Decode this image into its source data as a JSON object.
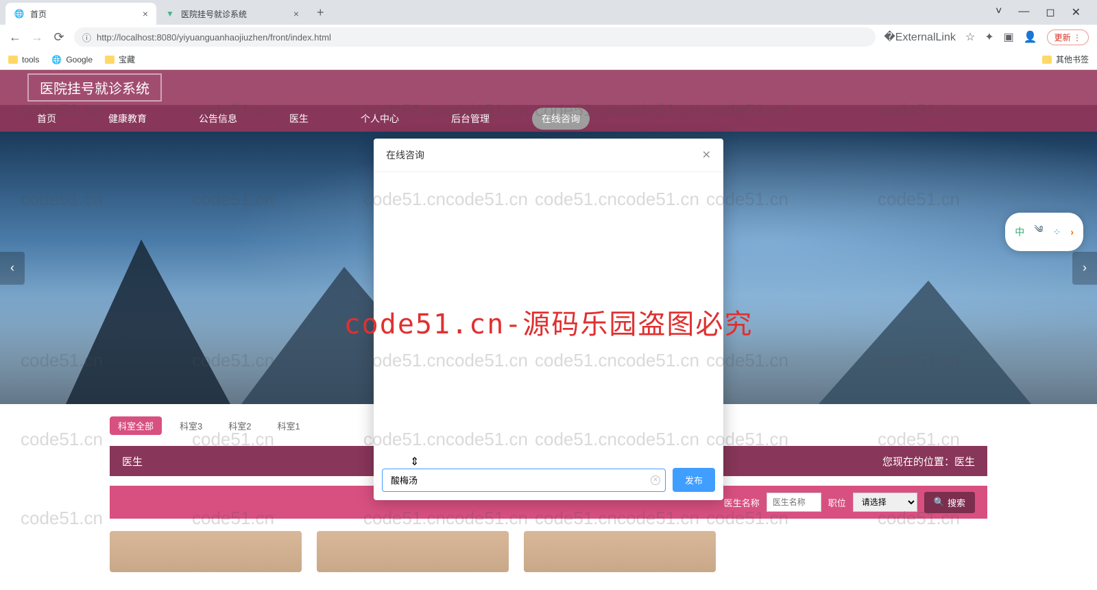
{
  "browser": {
    "tabs": [
      {
        "title": "首页",
        "icon": "globe"
      },
      {
        "title": "医院挂号就诊系统",
        "icon": "vue"
      }
    ],
    "url": "http://localhost:8080/yiyuanguanhaojiuzhen/front/index.html",
    "url_prefix_icon": "ⓘ",
    "bookmarks": [
      {
        "label": "tools",
        "type": "folder"
      },
      {
        "label": "Google",
        "type": "globe"
      },
      {
        "label": "宝藏",
        "type": "folder"
      }
    ],
    "bookmark_other": "其他书签",
    "update_label": "更新"
  },
  "site": {
    "title": "医院挂号就诊系统",
    "nav": [
      "首页",
      "健康教育",
      "公告信息",
      "医生",
      "个人中心",
      "后台管理",
      "在线咨询"
    ]
  },
  "filters": {
    "tags": [
      "科室全部",
      "科室3",
      "科室2",
      "科室1"
    ],
    "active_index": 0
  },
  "section": {
    "title": "医生",
    "breadcrumb": "您现在的位置：医生"
  },
  "search": {
    "label_name": "医生名称",
    "placeholder_name": "医生名称",
    "label_position": "职位",
    "select_placeholder": "请选择",
    "button": "搜索"
  },
  "modal": {
    "title": "在线咨询",
    "input_value": "酸梅汤",
    "send": "发布"
  },
  "ime": {
    "lang": "中"
  },
  "watermark_text": "code51.cn",
  "big_text": "code51.cn-源码乐园盗图必究"
}
